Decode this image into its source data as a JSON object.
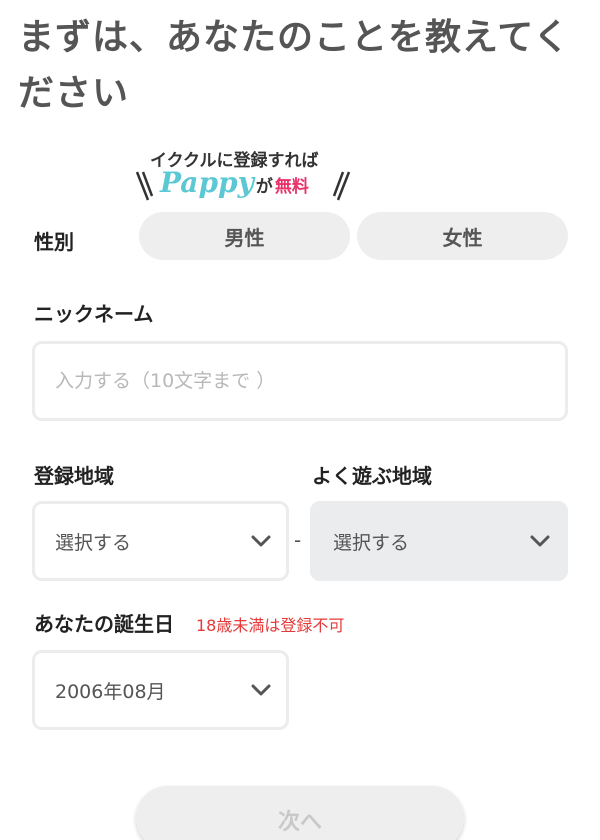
{
  "title": {
    "line1": "まずは、あなたのことを教えてく",
    "line2": "ださい"
  },
  "promo": {
    "line1": "イククルに登録すれば",
    "brand": "Pappy",
    "ga": "が",
    "free": "無料"
  },
  "gender": {
    "label": "性別",
    "options": [
      "男性",
      "女性"
    ]
  },
  "nickname": {
    "label": "ニックネーム",
    "placeholder": "入力する（10文字まで ）"
  },
  "region": {
    "label": "登録地域",
    "value": "選択する"
  },
  "separator": "-",
  "play_area": {
    "label": "よく遊ぶ地域",
    "value": "選択する"
  },
  "birthday": {
    "label": "あなたの誕生日",
    "warning": "18歳未満は登録不可",
    "value": "2006年08月"
  },
  "next_button": "次へ",
  "icons": [
    "chevron-down-icon"
  ],
  "colors": {
    "brand_teal": "#5cc8d4",
    "free_pink": "#e8336a",
    "warning_red": "#e53a3a",
    "pill_bg": "#eeeeee",
    "disabled_select_bg": "#eaecee"
  }
}
